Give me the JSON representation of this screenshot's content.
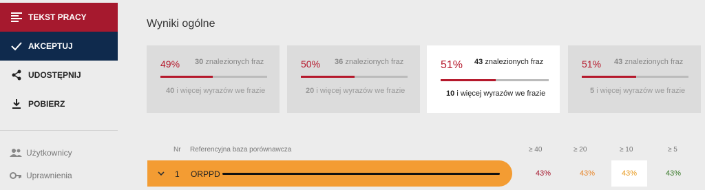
{
  "sidebar": {
    "items": [
      {
        "label": "TEKST PRACY",
        "icon": "text-lines-icon"
      },
      {
        "label": "AKCEPTUJ",
        "icon": "checkmark-icon"
      },
      {
        "label": "UDOSTĘPNIJ",
        "icon": "share-icon"
      },
      {
        "label": "POBIERZ",
        "icon": "download-icon"
      }
    ],
    "sub_items": [
      {
        "label": "Użytkownicy",
        "icon": "users-icon"
      },
      {
        "label": "Uprawnienia",
        "icon": "key-icon"
      }
    ]
  },
  "main": {
    "title": "Wyniki ogólne",
    "cards": [
      {
        "percent": "49%",
        "found_count": "30",
        "found_label": "znalezionych fraz",
        "bar_fill": 0.49,
        "min_words": "40",
        "min_words_label": "i więcej wyrazów we frazie",
        "active": false
      },
      {
        "percent": "50%",
        "found_count": "36",
        "found_label": "znalezionych fraz",
        "bar_fill": 0.5,
        "min_words": "20",
        "min_words_label": "i więcej wyrazów we frazie",
        "active": false
      },
      {
        "percent": "51%",
        "found_count": "43",
        "found_label": "znalezionych fraz",
        "bar_fill": 0.51,
        "min_words": "10",
        "min_words_label": "i więcej wyrazów we frazie",
        "active": true
      },
      {
        "percent": "51%",
        "found_count": "43",
        "found_label": "znalezionych fraz",
        "bar_fill": 0.51,
        "min_words": "5",
        "min_words_label": "i więcej wyrazów we frazie",
        "active": false
      }
    ],
    "table": {
      "headers": {
        "nr": "Nr",
        "base": "Referencyjna baza porównawcza",
        "c40": "≥ 40",
        "c20": "≥ 20",
        "c10": "≥ 10",
        "c5": "≥ 5"
      },
      "rows": [
        {
          "nr": "1",
          "name": "ORPPD",
          "scores": [
            "43%",
            "43%",
            "43%",
            "43%"
          ]
        }
      ]
    }
  },
  "colors": {
    "brand_red": "#a6192e",
    "navy": "#0f2a4d",
    "row_orange": "#f39c33",
    "score_colors": [
      "#a6192e",
      "#e8862a",
      "#e89a1f",
      "#3a7a2a"
    ]
  }
}
